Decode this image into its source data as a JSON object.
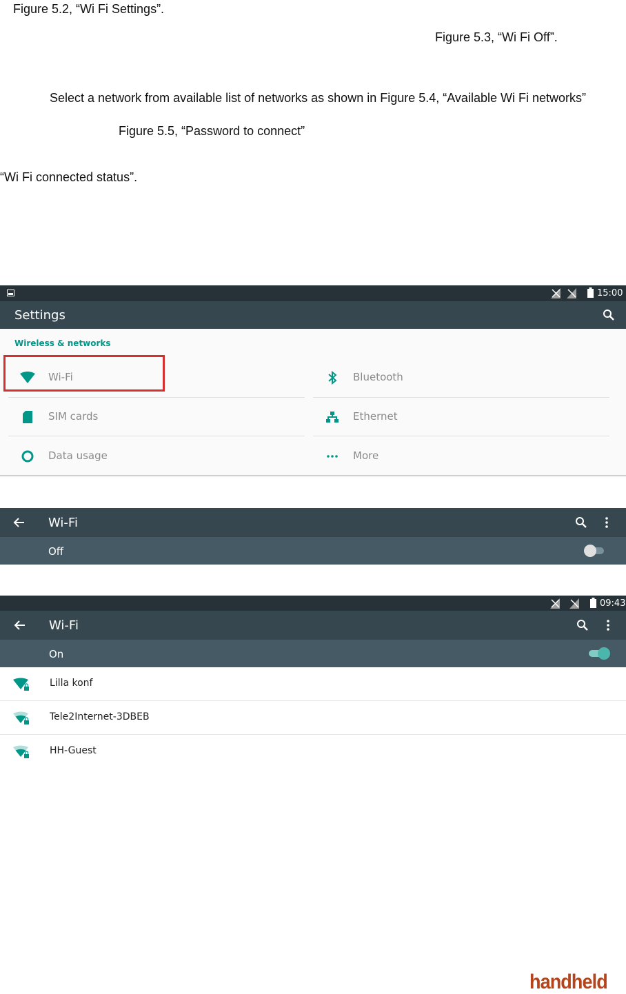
{
  "doc": {
    "line1": "Figure 5.2, “Wi Fi Settings”.",
    "line2": "Figure 5.3, “Wi Fi Off”.",
    "line3": "Select a network from available list of networks as shown in Figure 5.4, “Available Wi Fi networks”",
    "line4": "Figure 5.5, “Password to connect”",
    "line5": "“Wi Fi connected status”."
  },
  "settings_screen": {
    "status_time": "15:00",
    "title": "Settings",
    "section": "Wireless & networks",
    "tiles": [
      {
        "label": "Wi-Fi",
        "icon": "wifi-icon"
      },
      {
        "label": "Bluetooth",
        "icon": "bluetooth-icon"
      },
      {
        "label": "SIM cards",
        "icon": "sim-card-icon"
      },
      {
        "label": "Ethernet",
        "icon": "ethernet-icon"
      },
      {
        "label": "Data usage",
        "icon": "data-usage-icon"
      },
      {
        "label": "More",
        "icon": "more-dots-icon"
      }
    ],
    "accent": "#009688",
    "highlight_color": "#d32f2f"
  },
  "wifi_off_screen": {
    "title": "Wi-Fi",
    "state": "Off",
    "switch_on": false
  },
  "wifi_on_screen": {
    "status_time": "09:43",
    "title": "Wi-Fi",
    "state": "On",
    "switch_on": true,
    "networks": [
      {
        "name": "Lilla konf",
        "strength": "full",
        "secured": true
      },
      {
        "name": "Tele2Internet-3DBEB",
        "strength": "medium",
        "secured": true
      },
      {
        "name": "HH-Guest",
        "strength": "medium",
        "secured": true
      }
    ]
  },
  "brand": "handheld"
}
